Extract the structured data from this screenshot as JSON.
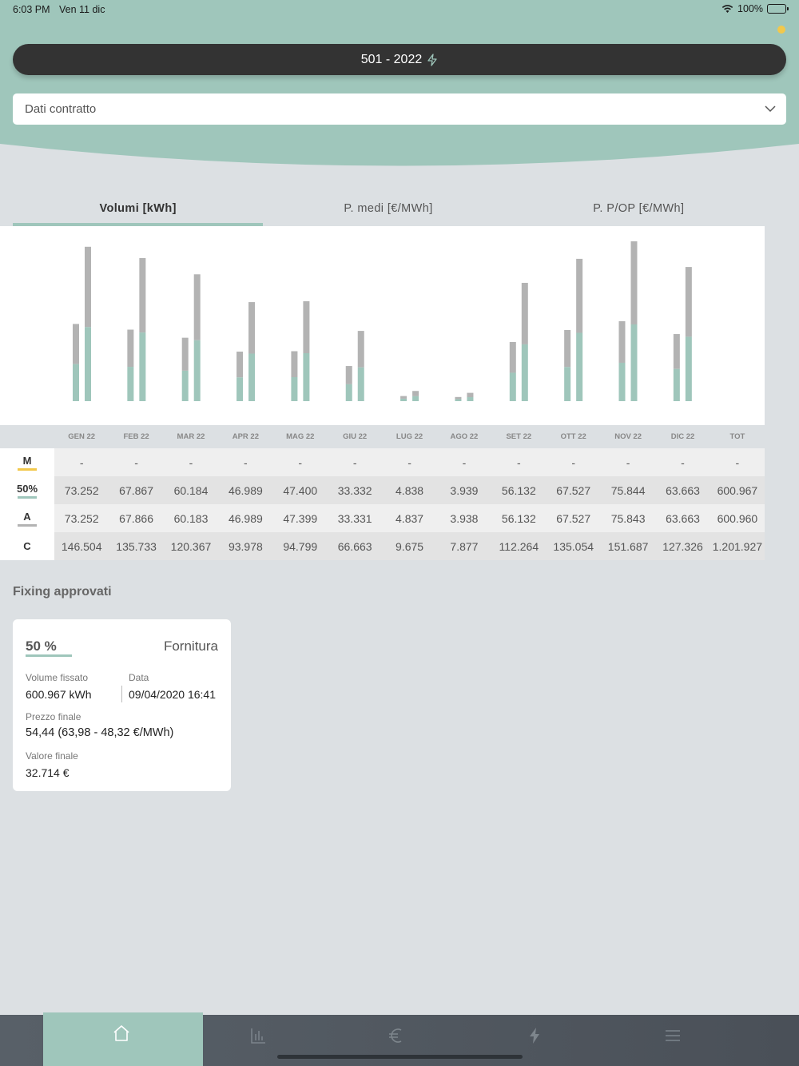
{
  "status_bar": {
    "time": "6:03 PM",
    "date": "Ven 11 dic",
    "battery": "100%"
  },
  "header": {
    "contract_label": "501 - 2022",
    "dropdown_label": "Dati contratto"
  },
  "tabs": [
    {
      "label": "Volumi [kWh]",
      "active": true
    },
    {
      "label": "P. medi [€/MWh]",
      "active": false
    },
    {
      "label": "P. P/OP [€/MWh]",
      "active": false
    }
  ],
  "colors": {
    "accent": "#9fc6bb",
    "bar_gray": "#b3b3b3",
    "M": "#f2c84b",
    "50%": "#9fc6bb",
    "A": "#b3b3b3"
  },
  "chart_data": {
    "type": "bar",
    "categories": [
      "GEN 22",
      "FEB 22",
      "MAR 22",
      "APR 22",
      "MAG 22",
      "GIU 22",
      "LUG 22",
      "AGO 22",
      "SET 22",
      "OTT 22",
      "NOV 22",
      "DIC 22"
    ],
    "series": [
      {
        "name": "50%",
        "values": [
          73252,
          67867,
          60184,
          46989,
          47400,
          33332,
          4838,
          3939,
          56132,
          67527,
          75844,
          63663
        ]
      },
      {
        "name": "C",
        "values": [
          146504,
          135733,
          120367,
          93978,
          94799,
          66663,
          9675,
          7877,
          112264,
          135054,
          151687,
          127326
        ]
      }
    ],
    "ylim": [
      0,
      160000
    ]
  },
  "table": {
    "columns": [
      "GEN 22",
      "FEB 22",
      "MAR 22",
      "APR 22",
      "MAG 22",
      "GIU 22",
      "LUG 22",
      "AGO 22",
      "SET 22",
      "OTT 22",
      "NOV 22",
      "DIC 22",
      "TOT"
    ],
    "rows": [
      {
        "label": "M",
        "cells": [
          "-",
          "-",
          "-",
          "-",
          "-",
          "-",
          "-",
          "-",
          "-",
          "-",
          "-",
          "-",
          "-"
        ]
      },
      {
        "label": "50%",
        "cells": [
          "73.252",
          "67.867",
          "60.184",
          "46.989",
          "47.400",
          "33.332",
          "4.838",
          "3.939",
          "56.132",
          "67.527",
          "75.844",
          "63.663",
          "600.967"
        ]
      },
      {
        "label": "A",
        "cells": [
          "73.252",
          "67.866",
          "60.183",
          "46.989",
          "47.399",
          "33.331",
          "4.837",
          "3.938",
          "56.132",
          "67.527",
          "75.843",
          "63.663",
          "600.960"
        ]
      },
      {
        "label": "C",
        "cells": [
          "146.504",
          "135.733",
          "120.367",
          "93.978",
          "94.799",
          "66.663",
          "9.675",
          "7.877",
          "112.264",
          "135.054",
          "151.687",
          "127.326",
          "1.201.927"
        ]
      }
    ]
  },
  "fixing": {
    "title": "Fixing approvati",
    "card": {
      "percent": "50 %",
      "kind": "Fornitura",
      "volume_label": "Volume fissato",
      "volume_value": "600.967 kWh",
      "date_label": "Data",
      "date_value": "09/04/2020 16:41",
      "price_label": "Prezzo finale",
      "price_value": "54,44  (63,98 - 48,32 €/MWh)",
      "value_label": "Valore finale",
      "value_value": "32.714 €"
    }
  },
  "bottom_nav": [
    "home-icon",
    "chart-icon",
    "euro-icon",
    "bolt-icon",
    "menu-icon"
  ]
}
